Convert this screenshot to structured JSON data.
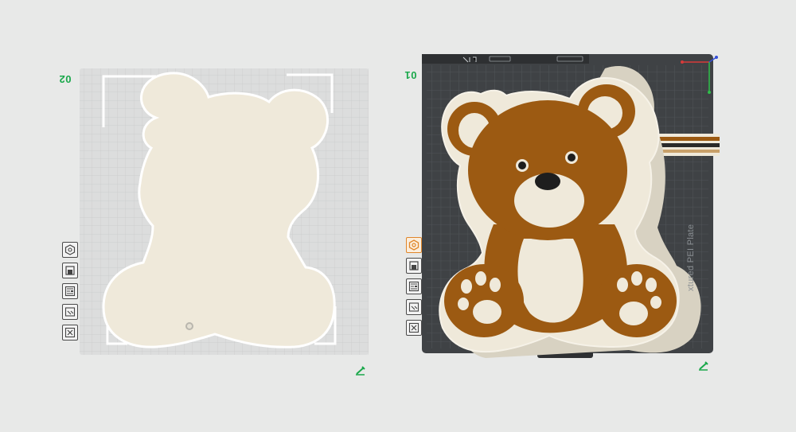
{
  "plates": [
    {
      "label": "02",
      "edit_icon": "edit-plate-icon"
    },
    {
      "label": "01",
      "edit_icon": "edit-plate-icon",
      "bed_text": "xtured PEI Plate"
    }
  ],
  "toolbar_icons": [
    "orient-icon",
    "arrange-icon",
    "layout-icon",
    "object-list-icon",
    "delete-plate-icon"
  ],
  "colors": {
    "background": "#e8e9e8",
    "grid_plate": "#d9dadb",
    "pei_bed": "#3f4245",
    "cream": "#efe9da",
    "bear_brown": "#9c5a12",
    "accent_green": "#1aa84b",
    "active_orange": "#e0862a"
  }
}
